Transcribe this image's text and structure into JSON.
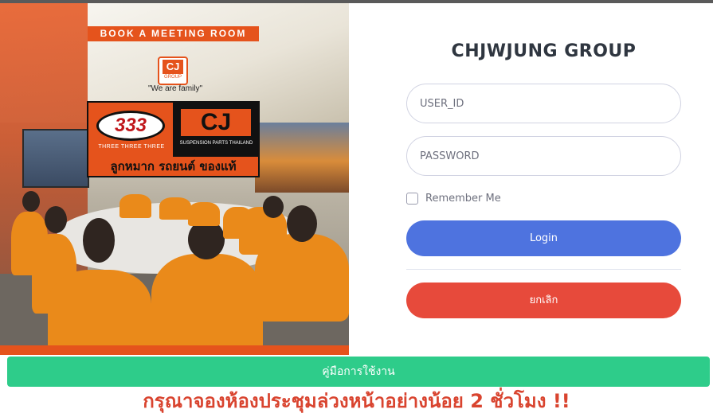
{
  "promo": {
    "banner": "BOOK A MEETING ROOM",
    "company_logo_text": "CJ",
    "company_logo_sub": "GROUP",
    "tagline": "\"We are family\"",
    "brand_333": "333",
    "brand_333_sub": "THREE THREE THREE",
    "brand_cj": "CJ",
    "brand_cj_sub": "SUSPENSION PARTS THAILAND",
    "brand_slogan": "ลูกหมาก รถยนต์ ของแท้"
  },
  "login": {
    "title": "CHJWJUNG GROUP",
    "user_placeholder": "USER_ID",
    "password_placeholder": "PASSWORD",
    "remember_label": "Remember Me",
    "login_label": "Login",
    "cancel_label": "ยกเลิก"
  },
  "footer": {
    "manual_label": "คู่มือการใช้งาน",
    "notice": "กรุณาจองห้องประชุมล่วงหน้าอย่างน้อย 2 ชั่วโมง !!"
  },
  "colors": {
    "primary": "#4e73df",
    "danger": "#e74a3b",
    "success": "#2ecc8a",
    "brand_orange": "#e5531c",
    "notice_red": "#d9442f"
  }
}
